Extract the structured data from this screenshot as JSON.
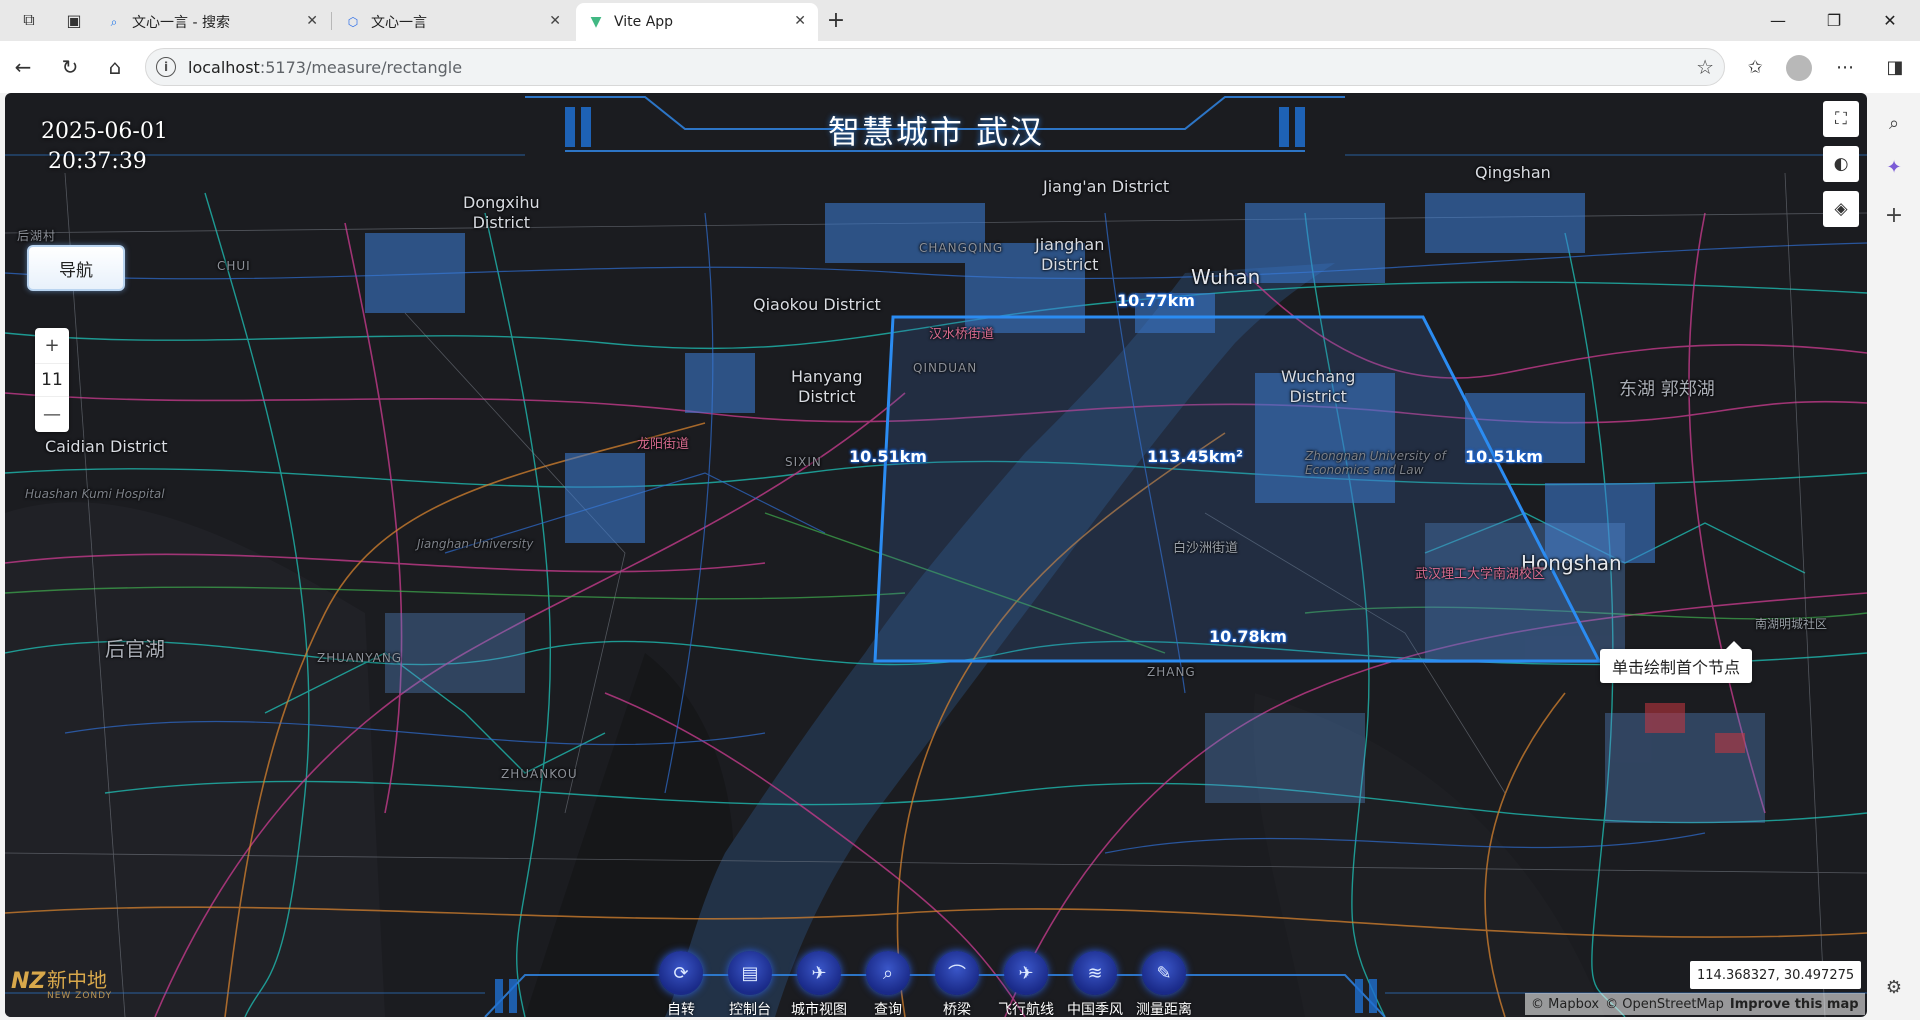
{
  "browser": {
    "tabs": [
      {
        "title": "文心一言 - 搜索",
        "active": false
      },
      {
        "title": "文心一言",
        "active": false
      },
      {
        "title": "Vite App",
        "active": true
      }
    ],
    "url_host": "localhost",
    "url_path": ":5173/measure/rectangle"
  },
  "app": {
    "title": "智慧城市 武汉",
    "date": "2025-06-01",
    "time": "20:37:39",
    "nav_toggle": "导航",
    "zoom_level": "11",
    "tooltip": "单击绘制首个节点",
    "coordinates": "114.368327, 30.497275",
    "attribution": {
      "mapbox": "© Mapbox",
      "osm": "© OpenStreetMap",
      "improve": "Improve this map"
    },
    "brand": {
      "name": "新中地",
      "sub": "NEW ZONDY"
    },
    "measure": {
      "top": "10.77km",
      "left": "10.51km",
      "right": "10.51km",
      "bottom": "10.78km",
      "area": "113.45km²"
    },
    "toolbar": [
      {
        "label": "自转",
        "icon": "rotate-icon"
      },
      {
        "label": "控制台",
        "icon": "console-icon"
      },
      {
        "label": "城市视图",
        "icon": "city-view-icon"
      },
      {
        "label": "查询",
        "icon": "query-icon"
      },
      {
        "label": "桥梁",
        "icon": "bridge-icon"
      },
      {
        "label": "飞行航线",
        "icon": "flight-route-icon"
      },
      {
        "label": "中国季风",
        "icon": "monsoon-icon"
      },
      {
        "label": "测量距离",
        "icon": "measure-distance-icon"
      }
    ],
    "places": {
      "dongxihu": "Dongxihu\nDistrict",
      "jianghan": "Jianghan\nDistrict",
      "jiangan": "Jiang'an District",
      "wuhan": "Wuhan",
      "qingshan": "Qingshan",
      "qiaokou": "Qiaokou District",
      "hanyang": "Hanyang\nDistrict",
      "wuchang": "Wuchang\nDistrict",
      "caidian": "Caidian District",
      "hongshan": "Hongshan",
      "houguanhu": "后官湖",
      "donghu": "东湖 郭郑湖",
      "zhuanyang": "ZHUANYANG",
      "zhuankou": "ZHUANKOU",
      "qinduan": "QINDUAN",
      "sixin": "SIXIN",
      "zhang": "ZHANG",
      "changqing": "CHANGQING",
      "baishazhou": "白沙洲街道",
      "longyang": "龙阳街道",
      "hanshui": "汉水桥街道",
      "wutech": "武汉理工大学南湖校区",
      "nanhu": "南湖明城社区",
      "jianghanuni": "Jianghan University",
      "huazhong": "Huashan Kumi Hospital",
      "zhongnan": "Zhongnan University of\nEconomics and Law",
      "chui": "CHUI",
      "houhu": "后湖村"
    }
  }
}
